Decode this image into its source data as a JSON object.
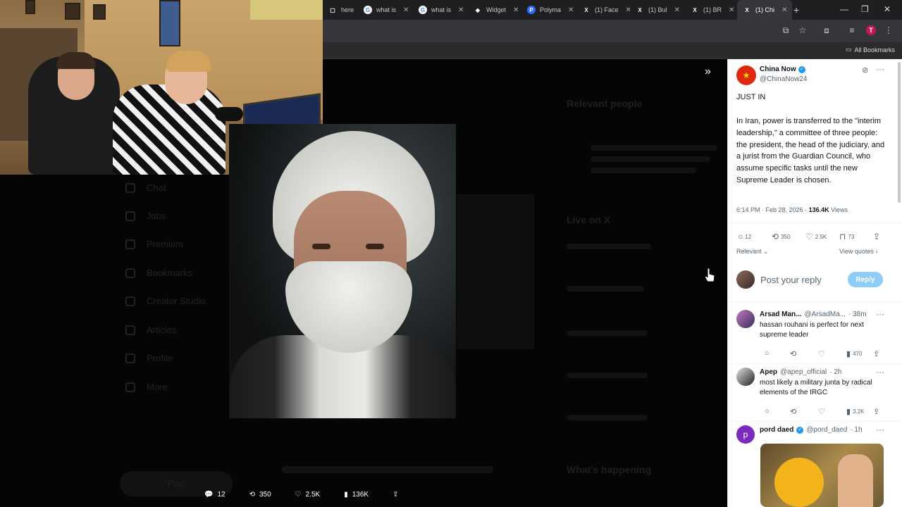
{
  "browser": {
    "tabs": [
      {
        "label": "here",
        "icon": "doc-icon",
        "color": "#555555"
      },
      {
        "label": "what is",
        "icon": "google-icon",
        "color": "#ffffff"
      },
      {
        "label": "what is",
        "icon": "google-icon",
        "color": "#ffffff"
      },
      {
        "label": "Widget",
        "icon": "widget-icon",
        "color": "#ffffff"
      },
      {
        "label": "Polyma",
        "icon": "polymarket-icon",
        "color": "#2f6bff"
      },
      {
        "label": "(1) Face",
        "icon": "x-icon",
        "color": "#ffffff"
      },
      {
        "label": "(1) Bul",
        "icon": "x-icon",
        "color": "#ffffff"
      },
      {
        "label": "(1) BR",
        "icon": "x-icon",
        "color": "#ffffff"
      },
      {
        "label": "(1) Chi",
        "icon": "x-icon",
        "color": "#ffffff",
        "active": true
      }
    ],
    "new_tab": "+",
    "bookmarks_label": "All Bookmarks",
    "profile_initial": "T"
  },
  "background_page": {
    "nav": [
      "Chat",
      "Jobs",
      "Premium",
      "Bookmarks",
      "Creator Studio",
      "Articles",
      "Profile",
      "More"
    ],
    "post_label": "Post",
    "relevant_people": "Relevant people",
    "live_on_x": "Live on X",
    "whats_happening": "What's happening"
  },
  "stats": {
    "replies": "12",
    "reposts": "350",
    "likes": "2.5K",
    "views": "136K"
  },
  "tweet": {
    "author": "China Now",
    "handle": "@ChinaNow24",
    "text_1": "JUST IN",
    "text_2": "In Iran, power is transferred to the \"interim leadership,\" a committee of three people: the president, the head of the judiciary, and a jurist from the Guardian Council, who assume specific tasks until the new Supreme Leader is chosen.",
    "time": "6:14 PM · Feb 28, 2026 · ",
    "views_count": "136.4K",
    "views_label": " Views",
    "replies": "12",
    "reposts": "350",
    "likes": "2.5K",
    "bookmarks": "73",
    "sort": "Relevant",
    "view_quotes": "View quotes",
    "reply_placeholder": "Post your reply",
    "reply_button": "Reply"
  },
  "replies": [
    {
      "name": "Arsad Man...",
      "handle": "@ArsadMa...",
      "time": "· 38m",
      "text": "hassan rouhani is perfect for next supreme leader",
      "views": "470"
    },
    {
      "name": "Apep",
      "handle": "@apep_official",
      "time": "· 2h",
      "text": "most likely a military junta by radical elements of the IRGC",
      "views": "3.2K"
    },
    {
      "name": "pord daed",
      "handle": "@pord_daed",
      "time": "· 1h",
      "text": "",
      "views": ""
    }
  ],
  "colors": {
    "accent": "#1d9bf0",
    "reply_button": "#8ecdf8"
  }
}
